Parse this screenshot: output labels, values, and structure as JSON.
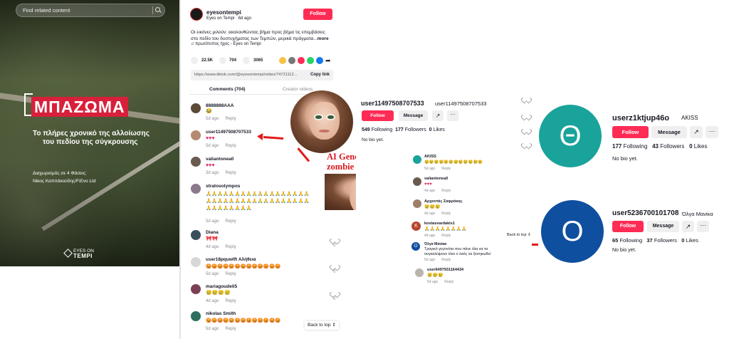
{
  "video": {
    "search_placeholder": "Find related content",
    "title": "ΜΠΑΖΩΜΑ",
    "subtitle_line1": "Το πλήρες χρονικό της αλλοίωσης",
    "subtitle_line2": "του πεδίου της σύγκρουσης",
    "credit_line1": "Διαχωρισμός σε 4 Φάσεις:",
    "credit_line2": "Νίκος Καππάκούδης/FiEvo Ltd",
    "logo_top": "EYES ON",
    "logo_bottom": "TEMPI"
  },
  "post": {
    "username": "eyesontempi",
    "meta": "Eyes on Tempi · 6d ago",
    "follow_label": "Follow",
    "caption": "Οι εικόνες μιλούν: ακολουθώντας βήμα προς βήμα τις επεμβάσεις στο πεδίο του δυστυχήματος των Τεμπών, μερικά πράγματα...",
    "more_label": "more",
    "sound": "πρωτότυπος ήχος - Eyes on Tempi",
    "likes": "22.5K",
    "comments_count": "704",
    "saves": "3065",
    "link": "https://www.tiktok.com/@eyesontempi/video/74721112...",
    "copy_label": "Copy link",
    "tab_comments": "Comments (704)",
    "tab_creator": "Creator videos"
  },
  "comments": [
    {
      "user": "8888888AAA",
      "text": "😂",
      "meta": "5d ago",
      "reply": "Reply"
    },
    {
      "user": "user11497508707533",
      "text": "♥♥♥",
      "meta": "5d ago",
      "reply": "Reply"
    },
    {
      "user": "valiantonea0",
      "text": "♥♥♥",
      "meta": "3d ago",
      "reply": "Reply"
    },
    {
      "user": "stratosolympos",
      "text": "🙏🙏🙏🙏🙏🙏🙏🙏🙏🙏🙏🙏🙏🙏🙏🙏🙏🙏🙏🙏🙏🙏🙏🙏🙏🙏🙏🙏🙏🙏🙏🙏🙏🙏🙏🙏🙏🙏🙏🙏🙏🙏🙏🙏",
      "meta": "5d ago",
      "reply": "Reply"
    },
    {
      "user": "Diana",
      "text": "🎀🎀",
      "meta": "4d ago",
      "reply": "Reply",
      "likes": "0"
    },
    {
      "user": "user18pquwlft Αλήθεια",
      "text": "😡😡😡😡😡😡😡😡😡😡😡😡😡",
      "meta": "5d ago",
      "reply": "Reply",
      "likes": "0"
    },
    {
      "user": "mariagoudeli5",
      "text": "😢😢😢😢",
      "meta": "4d ago",
      "reply": "Reply",
      "likes": "0"
    },
    {
      "user": "nikolas Smith",
      "text": "😡😡😡😡😡😡😡😡😡😡😡😡😡",
      "meta": "5d ago",
      "reply": "Reply"
    }
  ],
  "back_to_top": "Back to top",
  "annotation": {
    "line1": "AI Generated picture",
    "line2": "zombie eyes"
  },
  "profile1": {
    "username": "user11497508707533",
    "nickname": "user11497508707533",
    "follow": "Follow",
    "message": "Message",
    "following_num": "549",
    "following_label": "Following",
    "followers_num": "177",
    "followers_label": "Followers",
    "likes_num": "0",
    "likes_label": "Likes",
    "bio": "No bio yet."
  },
  "inner_comments": [
    {
      "user": "AKISS",
      "text": "😢😢😢😢😢😢😢😢😢😢😢😢",
      "meta": "5d ago",
      "reply": "Reply"
    },
    {
      "user": "valiantonea0",
      "text": "♥♥♥",
      "meta": "4d ago",
      "reply": "Reply"
    },
    {
      "user": "Αρχοντάς Σαφρόκης",
      "text": "😢😢😢",
      "meta": "4d ago",
      "reply": "Reply"
    },
    {
      "user": "kostasvardakis1",
      "text": "🙏🙏🙏🙏🙏🙏🙏🙏",
      "meta": "4d ago",
      "reply": "Reply"
    },
    {
      "user": "Όλγα Μανίκα",
      "text": "Τραγικό γεγονότα που πάνε όλα να τα συγκαλύψουν όλοι ο λαός να ξεσηκωθεί",
      "meta": "5d ago",
      "reply": "Reply"
    },
    {
      "user": "user6497931164434",
      "text": "😢😢😢",
      "meta": "5d ago",
      "reply": "Reply"
    }
  ],
  "inner_back_to_top": "Back to top",
  "profile2": {
    "letter": "Θ",
    "username": "userz1ktjup46o",
    "nickname": "AKISS",
    "follow": "Follow",
    "message": "Message",
    "following_num": "177",
    "following_label": "Following",
    "followers_num": "43",
    "followers_label": "Followers",
    "likes_num": "0",
    "likes_label": "Likes",
    "bio": "No bio yet."
  },
  "profile3": {
    "letter": "O",
    "username": "user5236700101708",
    "nickname": "Όλγα Μανίκα",
    "follow": "Follow",
    "message": "Message",
    "following_num": "65",
    "following_label": "Following",
    "followers_num": "37",
    "followers_label": "Followers",
    "likes_num": "0",
    "likes_label": "Likes",
    "bio": "No bio yet."
  },
  "colors": {
    "accent": "#fe2c55",
    "arrow": "#e41a1a",
    "avatar_teal": "#1aa39a",
    "avatar_blue": "#0f4fa0"
  }
}
